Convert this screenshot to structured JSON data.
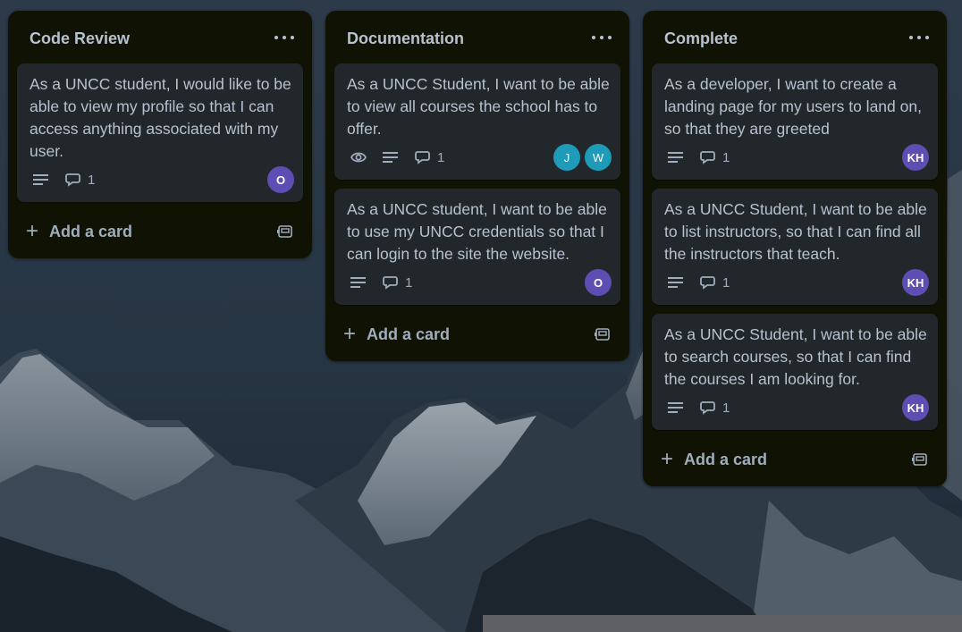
{
  "lists": [
    {
      "title": "Code Review",
      "cards": [
        {
          "title": "As a UNCC student, I would like to be able to view my profile so that I can access anything associated with my user.",
          "comments": "1",
          "members": [
            {
              "initials": "O",
              "color": "#5e4db2"
            }
          ]
        }
      ],
      "add_card": "Add a card"
    },
    {
      "title": "Documentation",
      "cards": [
        {
          "title": "As a UNCC Student, I want to be able to view all courses the school has to offer.",
          "comments": "1",
          "members": [
            {
              "initials": "J",
              "color": "#1d9bb8"
            },
            {
              "initials": "W",
              "color": "#1d9bb8"
            }
          ]
        },
        {
          "title": "As a UNCC student, I want to be able to use my UNCC credentials so that I can login to the site the website.",
          "comments": "1",
          "members": [
            {
              "initials": "O",
              "color": "#5e4db2"
            }
          ]
        }
      ],
      "add_card": "Add a card"
    },
    {
      "title": "Complete",
      "cards": [
        {
          "title": "As a developer, I want to create a landing page for my users to land on, so that they are greeted",
          "comments": "1",
          "members": [
            {
              "initials": "KH",
              "color": "#5e4db2"
            }
          ]
        },
        {
          "title": "As a UNCC Student, I want to be able to list instructors, so that I can find all the instructors that teach.",
          "comments": "1",
          "members": [
            {
              "initials": "KH",
              "color": "#5e4db2"
            }
          ]
        },
        {
          "title": "As a UNCC Student, I want to be able to search courses, so that I can find the courses I am looking for.",
          "comments": "1",
          "members": [
            {
              "initials": "KH",
              "color": "#5e4db2"
            }
          ]
        }
      ],
      "add_card": "Add a card"
    }
  ]
}
